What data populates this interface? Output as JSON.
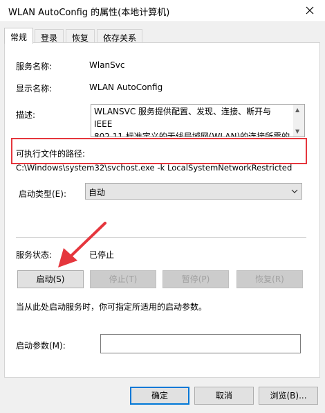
{
  "window": {
    "title": "WLAN AutoConfig 的属性(本地计算机)"
  },
  "tabs": [
    {
      "label": "常规",
      "active": true
    },
    {
      "label": "登录",
      "active": false
    },
    {
      "label": "恢复",
      "active": false
    },
    {
      "label": "依存关系",
      "active": false
    }
  ],
  "general": {
    "service_name_label": "服务名称:",
    "service_name_value": "WlanSvc",
    "display_name_label": "显示名称:",
    "display_name_value": "WLAN AutoConfig",
    "description_label": "描述:",
    "description_line1": "WLANSVC 服务提供配置、发现、连接、断开与 IEEE",
    "description_line2": "802.11 标准定义的无线局域网(WLAN)的连接所需的",
    "exe_path_label": "可执行文件的路径:",
    "exe_path_value": "C:\\Windows\\system32\\svchost.exe -k LocalSystemNetworkRestricted",
    "startup_type_label": "启动类型(E):",
    "startup_type_value": "自动",
    "service_status_label": "服务状态:",
    "service_status_value": "已停止",
    "hint": "当从此处启动服务时，你可指定所适用的启动参数。",
    "start_params_label": "启动参数(M):",
    "start_params_value": ""
  },
  "buttons": {
    "start": "启动(S)",
    "stop": "停止(T)",
    "pause": "暂停(P)",
    "resume": "恢复(R)",
    "ok": "确定",
    "cancel": "取消",
    "browse": "浏览(B)..."
  },
  "colors": {
    "highlight": "#e5363d",
    "focus": "#0078d7"
  },
  "icons": {
    "close": "close-icon",
    "dropdown": "chevron-down-icon",
    "annotation": "red-arrow-icon"
  }
}
